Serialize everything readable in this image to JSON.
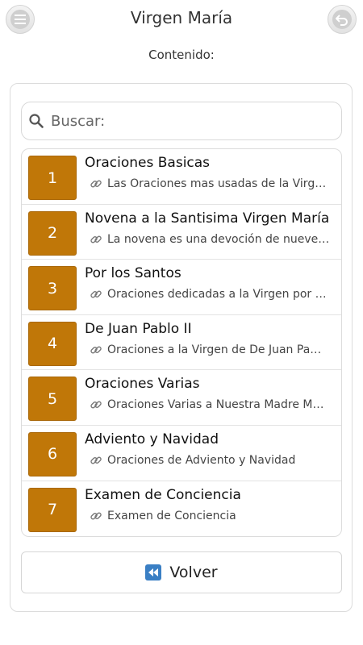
{
  "header": {
    "title": "Virgen María",
    "menu_icon": "menu-icon",
    "back_icon": "undo-arrow-icon"
  },
  "subtitle": "Contenido:",
  "search": {
    "placeholder": "Buscar:",
    "icon": "search-icon"
  },
  "items": [
    {
      "number": "1",
      "title": "Oraciones Basicas",
      "description": "Las Oraciones mas usadas de la Virg…"
    },
    {
      "number": "2",
      "title": "Novena a la Santisima Virgen María",
      "description": "La novena es una devoción de nueve…"
    },
    {
      "number": "3",
      "title": "Por los Santos",
      "description": "Oraciones dedicadas a la Virgen por …"
    },
    {
      "number": "4",
      "title": "De Juan Pablo II",
      "description": "Oraciones a la Virgen de De Juan Pa…"
    },
    {
      "number": "5",
      "title": "Oraciones Varias",
      "description": "Oraciones Varias a Nuestra Madre M…"
    },
    {
      "number": "6",
      "title": "Adviento y Navidad",
      "description": "Oraciones de Adviento y Navidad"
    },
    {
      "number": "7",
      "title": "Examen de Conciencia",
      "description": "Examen de Conciencia"
    }
  ],
  "volver_label": "Volver",
  "colors": {
    "accent": "#c07708",
    "volver_icon": "#3a7fc4"
  }
}
